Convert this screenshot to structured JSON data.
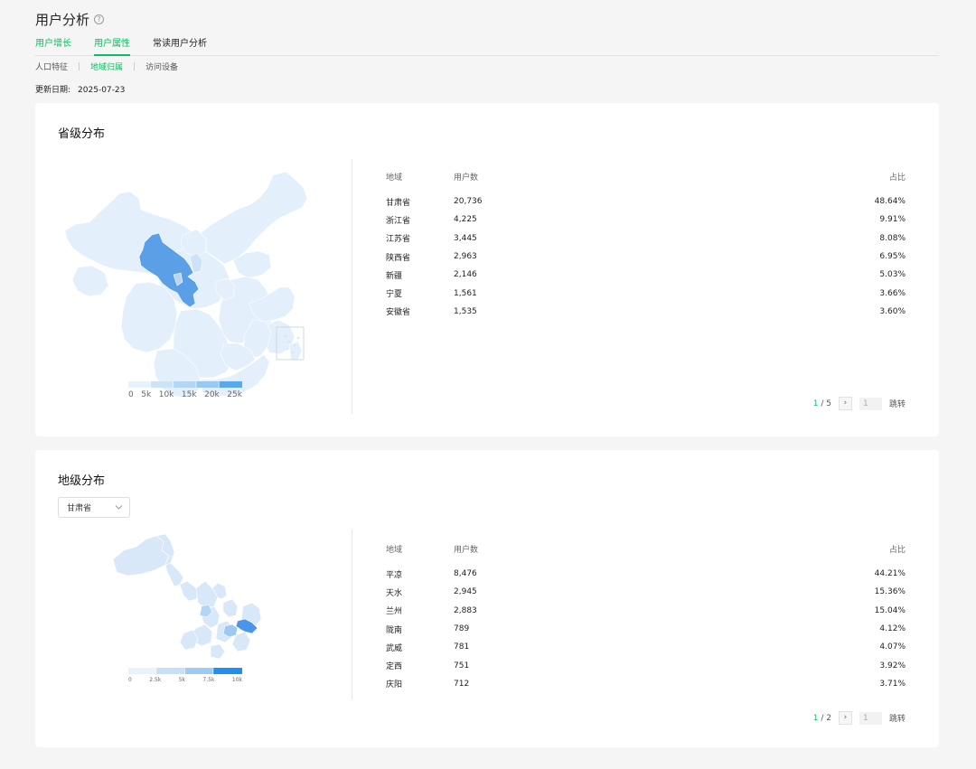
{
  "header": {
    "title": "用户分析",
    "help_icon": "?"
  },
  "tabs": [
    {
      "label": "用户增长"
    },
    {
      "label": "用户属性"
    },
    {
      "label": "常读用户分析"
    }
  ],
  "subtabs": [
    {
      "label": "人口特征"
    },
    {
      "label": "地域归属"
    },
    {
      "label": "访问设备"
    }
  ],
  "update": {
    "label": "更新日期:",
    "date": "2025-07-23"
  },
  "province": {
    "title": "省级分布",
    "columns": [
      "地域",
      "用户数",
      "占比"
    ],
    "rows": [
      [
        "甘肃省",
        "20,736",
        "48.64%"
      ],
      [
        "浙江省",
        "4,225",
        "9.91%"
      ],
      [
        "江苏省",
        "3,445",
        "8.08%"
      ],
      [
        "陕西省",
        "2,963",
        "6.95%"
      ],
      [
        "新疆",
        "2,146",
        "5.03%"
      ],
      [
        "宁夏",
        "1,561",
        "3.66%"
      ],
      [
        "安徽省",
        "1,535",
        "3.60%"
      ]
    ],
    "legend": [
      "0",
      "5k",
      "10k",
      "15k",
      "20k",
      "25k"
    ],
    "pager": {
      "current": "1",
      "total": "5",
      "input": "1",
      "jump": "跳转"
    }
  },
  "city": {
    "title": "地级分布",
    "select": "甘肃省",
    "columns": [
      "地域",
      "用户数",
      "占比"
    ],
    "rows": [
      [
        "平凉",
        "8,476",
        "44.21%"
      ],
      [
        "天水",
        "2,945",
        "15.36%"
      ],
      [
        "兰州",
        "2,883",
        "15.04%"
      ],
      [
        "陇南",
        "789",
        "4.12%"
      ],
      [
        "武威",
        "781",
        "4.07%"
      ],
      [
        "定西",
        "751",
        "3.92%"
      ],
      [
        "庆阳",
        "712",
        "3.71%"
      ]
    ],
    "legend": [
      "0",
      "2.5k",
      "5k",
      "7.5k",
      "10k"
    ],
    "pager": {
      "current": "1",
      "total": "2",
      "input": "1",
      "jump": "跳转"
    }
  },
  "colors": {
    "accent": "#07c160",
    "map_light": "#e2effb",
    "map_mid": "#c8e0f7",
    "map_dark": "#5b9fe6"
  }
}
